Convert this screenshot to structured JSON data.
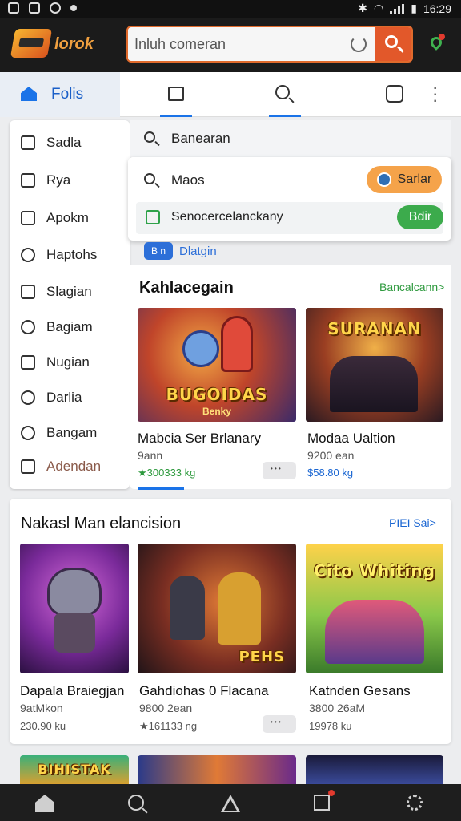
{
  "status_bar": {
    "time": "16:29"
  },
  "header": {
    "logo_text": "lorok",
    "search_value": "Inluh comeran"
  },
  "tabs": {
    "home_label": "Folis"
  },
  "sidebar": {
    "items": [
      {
        "label": "Sadla",
        "icon": "home-outline-icon"
      },
      {
        "label": "Rya",
        "icon": "home-outline-icon"
      },
      {
        "label": "Apokm",
        "icon": "bar-chart-icon"
      },
      {
        "label": "Haptohs",
        "icon": "power-icon"
      },
      {
        "label": "Slagian",
        "icon": "close-box-icon"
      },
      {
        "label": "Bagiam",
        "icon": "info-circle-icon"
      },
      {
        "label": "Nugian",
        "icon": "document-icon"
      },
      {
        "label": "Darlia",
        "icon": "sync-icon"
      },
      {
        "label": "Bangam",
        "icon": "compass-icon"
      },
      {
        "label": "Adendan",
        "icon": "chat-icon"
      }
    ]
  },
  "search_dropdown": {
    "query_row": "Banearan",
    "suggestion_1": "Maos",
    "suggestion_1_button": "Sarlar",
    "suggestion_2": "Senocercelanckany",
    "suggestion_2_button": "Bdir",
    "tag_badge": "B n",
    "tag_label": "Dlatgin"
  },
  "section1": {
    "title": "Kahlacegain",
    "link": "Bancalcann>",
    "cards": [
      {
        "image_title": "BUGOIDAS",
        "image_subtitle": "Benky",
        "name": "Mabcia Ser Brlanary",
        "sub": "9ann",
        "price": "★300333 kg"
      },
      {
        "image_title": "SURANAN",
        "name": "Modaa Ualtion",
        "sub": "9200 ean",
        "price": "$58.80 kg"
      }
    ]
  },
  "section2": {
    "title": "Nakasl Man elancision",
    "link": "PIEI Sai>",
    "cards": [
      {
        "name": "Dapala Braiegjan",
        "sub": "9atMkon",
        "price": "230.90 ku"
      },
      {
        "image_title": "PEHS",
        "name": "Gahdiohas 0 Flacana",
        "sub": "9800 2ean",
        "price": "★161133 ng"
      },
      {
        "image_title": "Cito Whiting",
        "name": "Katnden Gesans",
        "sub": "3800 26aM",
        "price": "19978 ku"
      }
    ]
  },
  "peek": {
    "image_title": "BIHISTAK"
  },
  "colors": {
    "accent": "#1a73e8",
    "orange": "#e2582a",
    "green": "#3cab4c"
  }
}
